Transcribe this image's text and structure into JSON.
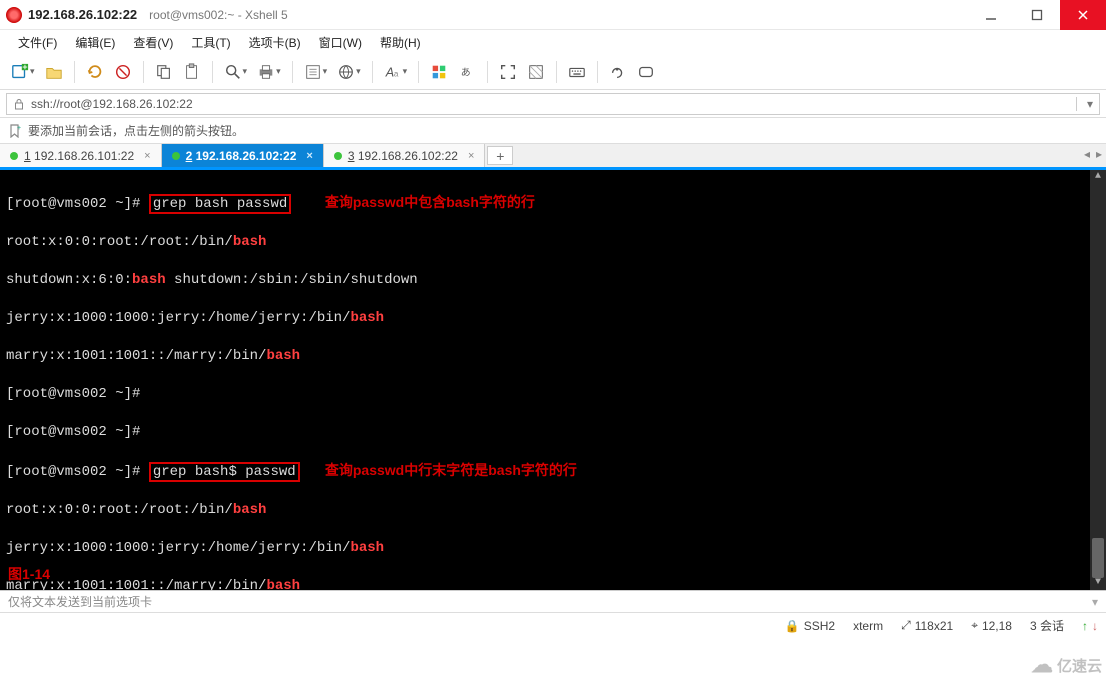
{
  "window": {
    "title_main": "192.168.26.102:22",
    "title_sub": "root@vms002:~ - Xshell 5"
  },
  "menu": {
    "file": "文件(F)",
    "edit": "编辑(E)",
    "view": "查看(V)",
    "tools": "工具(T)",
    "tabs": "选项卡(B)",
    "window": "窗口(W)",
    "help": "帮助(H)"
  },
  "address": {
    "url": "ssh://root@192.168.26.102:22"
  },
  "hint": {
    "text": "要添加当前会话，点击左侧的箭头按钮。"
  },
  "tabs": [
    {
      "num": "1",
      "label": "192.168.26.101:22",
      "active": false
    },
    {
      "num": "2",
      "label": "192.168.26.102:22",
      "active": true
    },
    {
      "num": "3",
      "label": "192.168.26.102:22",
      "active": false
    }
  ],
  "addtab_label": "+",
  "terminal": {
    "prompt": "[root@vms002 ~]#",
    "cmd1_boxed": "grep bash passwd",
    "ann1": "查询passwd中包含bash字符的行",
    "out1_pre": "root:x:0:0:root:/root:/bin/",
    "out1_hl": "bash",
    "out2_pre": "shutdown:x:6:0:",
    "out2_hl": "bash",
    "out2_post": " shutdown:/sbin:/sbin/shutdown",
    "out3_pre": "jerry:x:1000:1000:jerry:/home/jerry:/bin/",
    "out3_hl": "bash",
    "out4_pre": "marry:x:1001:1001::/marry:/bin/",
    "out4_hl": "bash",
    "cmd2_boxed": "grep bash$ passwd",
    "ann2": "查询passwd中行末字符是bash字符的行",
    "out5_pre": "root:x:0:0:root:/root:/bin/",
    "out5_hl": "bash",
    "out6_pre": "jerry:x:1000:1000:jerry:/home/jerry:/bin/",
    "out6_hl": "bash",
    "out7_pre": "marry:x:1001:1001::/marry:/bin/",
    "out7_hl": "bash",
    "figure_label": "图1-14"
  },
  "sendhint": "仅将文本发送到当前选项卡",
  "status": {
    "proto": "SSH2",
    "term": "xterm",
    "size": "118x21",
    "pos": "12,18",
    "sessions": "3 会话",
    "size_icon": "⤢",
    "pos_icon": "⌖",
    "proto_icon": "🔒",
    "up": "↑",
    "dn": "↓"
  },
  "watermark": "亿速云"
}
